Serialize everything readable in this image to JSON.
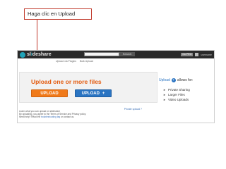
{
  "callout": {
    "text": "Haga clic en Upload"
  },
  "topbar": {
    "logo_prefix": "sl",
    "logo_accent": "i",
    "logo_suffix": "deshare",
    "search_button": "Search",
    "pro_badge": "Go PRO",
    "username": "username"
  },
  "subnav": {
    "items": [
      "Upload via Plugins",
      "Bulk Upload"
    ]
  },
  "upload_panel": {
    "title": "Upload one or more files",
    "upload_button": "UPLOAD",
    "upload_plus_button": "UPLOAD",
    "private_link": "Private upload ?"
  },
  "side_panel": {
    "title_prefix": "Upload",
    "title_suffix": "allows for:",
    "items": [
      "Private Sharing",
      "Larger Files",
      "Video Uploads"
    ]
  },
  "notes": {
    "line1": "Learn what you can upload on slideshare",
    "line2": "By uploading, you agree to the Terms of Service and Privacy policy.",
    "line3_prefix": "Need help? Read the ",
    "line3_link": "troubleshooting faq",
    "line3_suffix": " or contact us."
  },
  "colors": {
    "accent_orange": "#f07a1a",
    "accent_blue": "#2a74c2",
    "callout_border": "#c0392b",
    "logo_teal": "#1fa3b8"
  },
  "icons": {
    "logo": "slideshare-logo-icon",
    "upload_info": "upload-circle-icon",
    "bullet": "triangle-right-icon"
  }
}
